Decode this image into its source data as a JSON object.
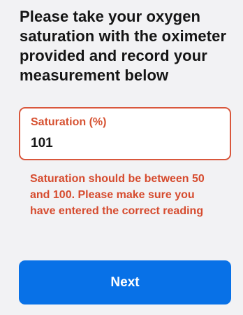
{
  "question": {
    "title": "Please take your oxygen saturation with the oximeter provided and record your measurement below"
  },
  "saturation_field": {
    "label": "Saturation (%)",
    "value": "101",
    "error": "Saturation should be between 50 and 100. Please make sure you have entered the correct reading"
  },
  "actions": {
    "next_label": "Next"
  },
  "colors": {
    "background": "#f2f2f4",
    "error": "#d65232",
    "primary_button": "#0871e7",
    "text": "#151515"
  }
}
